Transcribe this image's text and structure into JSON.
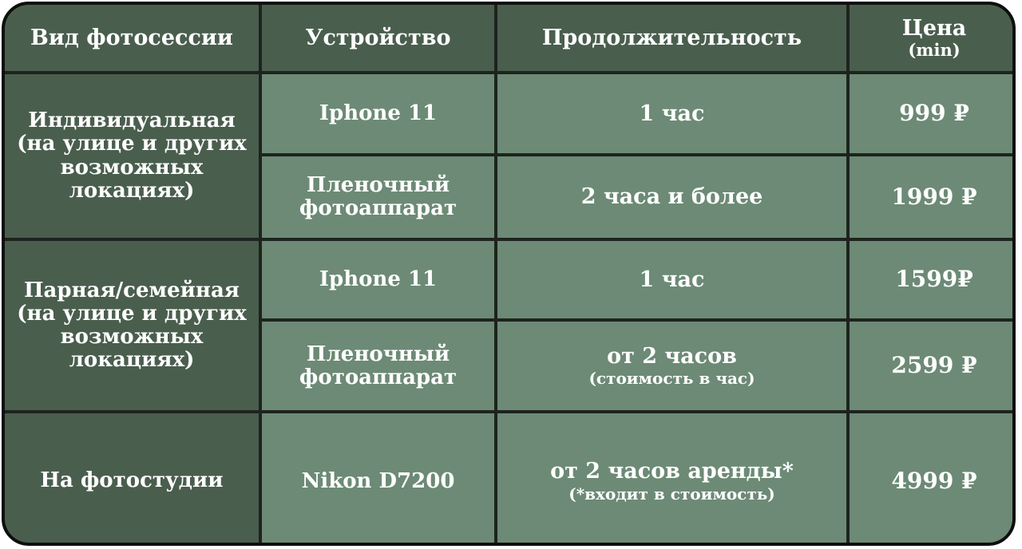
{
  "header": {
    "type_label": "Вид фотосессии",
    "device_label": "Устройство",
    "duration_label": "Продолжительность",
    "price_label": "Цена",
    "price_sub": "(min)"
  },
  "groups": [
    {
      "category": [
        "Индивидуальная",
        "(на улице и других",
        "возможных",
        "локациях)"
      ],
      "rows": [
        {
          "device": [
            "Iphone 11"
          ],
          "duration": "1 час",
          "duration_note": "",
          "price": "999 ₽"
        },
        {
          "device": [
            "Пленочный",
            "фотоаппарат"
          ],
          "duration": "2 часа и более",
          "duration_note": "",
          "price": "1999 ₽"
        }
      ]
    },
    {
      "category": [
        "Парная/семейная",
        "(на улице и других",
        "возможных",
        "локациях)"
      ],
      "rows": [
        {
          "device": [
            "Iphone 11"
          ],
          "duration": "1 час",
          "duration_note": "",
          "price": "1599₽"
        },
        {
          "device": [
            "Пленочный",
            "фотоаппарат"
          ],
          "duration": "от 2 часов",
          "duration_note": "(стоимость в час)",
          "price": "2599 ₽"
        }
      ]
    },
    {
      "category": [
        "На фотостудии"
      ],
      "rows": [
        {
          "device": [
            "Nikon D7200"
          ],
          "duration": "от 2 часов аренды*",
          "duration_note": "(*входит в стоимость)",
          "price": "4999 ₽"
        }
      ]
    }
  ]
}
